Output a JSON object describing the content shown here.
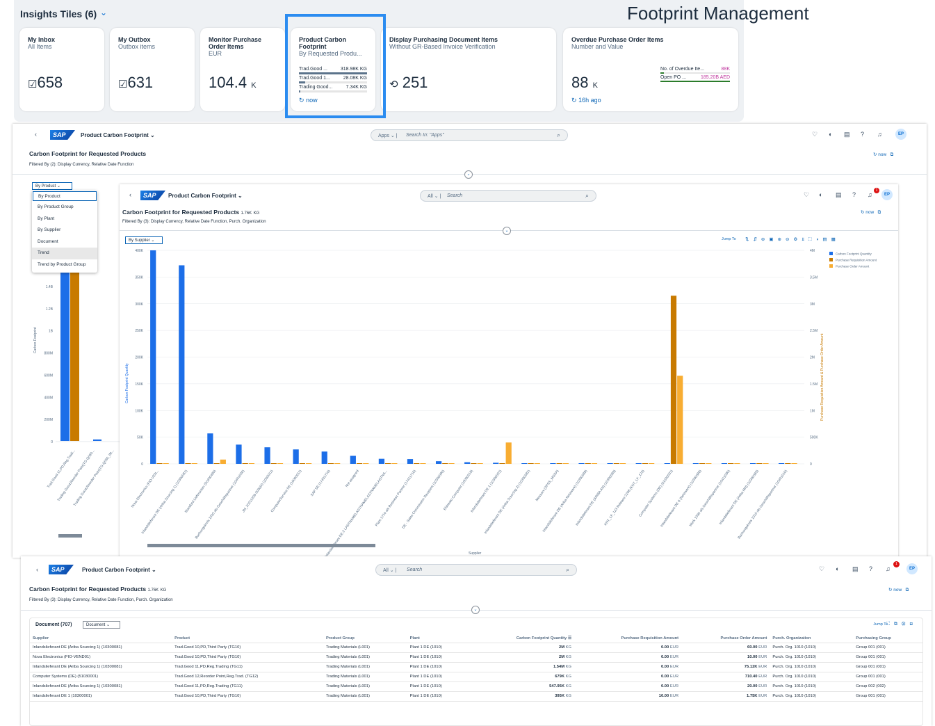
{
  "overlay": {
    "title": "Footprint Management"
  },
  "insights": {
    "title": "Insights Tiles (6)",
    "tiles": [
      {
        "title": "My Inbox",
        "subtitle": "All Items",
        "value": "658",
        "icon": "inbox-check-icon"
      },
      {
        "title": "My Outbox",
        "subtitle": "Outbox items",
        "value": "631",
        "icon": "outbox-check-icon"
      },
      {
        "title": "Monitor Purchase Order Items",
        "subtitle": "EUR",
        "value": "104.4",
        "unit": "K"
      },
      {
        "title": "Product Carbon Footprint",
        "subtitle": "By Requested Produ...",
        "rows": [
          {
            "label": "Trad.Good ...",
            "value": "318.98K KG",
            "fill": 1.0
          },
          {
            "label": "Trad.Good 1...",
            "value": "28.08K KG",
            "fill": 0.09
          },
          {
            "label": "Trading Good...",
            "value": "7.34K KG",
            "fill": 0.02
          }
        ],
        "refresh": "now"
      },
      {
        "title": "Display Purchasing Document Items",
        "subtitle": "Without GR-Based Invoice Verification",
        "value": "251",
        "icon": "document-sync-icon"
      },
      {
        "title": "Overdue Purchase Order Items",
        "subtitle": "Number and Value",
        "value": "88",
        "unit": "K",
        "rows": [
          {
            "label": "No. of Overdue Ite...",
            "value": "88K",
            "fill": 0.05
          },
          {
            "label": "Open PO ...",
            "value": "185.20B AED",
            "fill": 1.0
          }
        ],
        "refresh": "16h ago"
      }
    ]
  },
  "shell": {
    "app": "Product Carbon Footprint",
    "search_cat_apps": "Apps",
    "search_ph_apps": "Search In: \"Apps\"",
    "search_cat_all": "All",
    "search_ph_all": "Search",
    "avatar": "EP",
    "badge": "1"
  },
  "page": {
    "title": "Carbon Footprint for Requested Products",
    "total": "1.76K",
    "total_unit": "KG",
    "filter2": "Filtered By (2): Display Currency, Relative Date Function",
    "filter3": "Filtered By (3): Display Currency, Relative Date Function, Purch. Organization",
    "refresh": "now",
    "jump_to": "Jump To"
  },
  "back_chart": {
    "view": "By Product",
    "ylabel": "Carbon Footprint",
    "menu": [
      "By Product",
      "By Product Group",
      "By Plant",
      "By Supplier",
      "Document",
      "Trend",
      "Trend by Product Group"
    ],
    "ticks": [
      "1.4B",
      "1.2B",
      "1B",
      "800M",
      "600M",
      "400M",
      "200M",
      "0"
    ],
    "categories": [
      "Trad.Good 11,PD,Reg.Tradi...",
      "Trading Good,Reorder Point(TG-Q060...",
      "Trading Good,Reorder Point(TG-Q060_IM..."
    ]
  },
  "chart_data": {
    "type": "bar",
    "view": "By Supplier",
    "xlabel": "Supplier",
    "ylabel": "Carbon Footprint Quantity",
    "y2label": "Purchase Requisition Amount & Purchase Order Amount",
    "ylim": [
      0,
      400000
    ],
    "y2lim": [
      0,
      4000000
    ],
    "yticks": [
      "400K",
      "350K",
      "300K",
      "250K",
      "200K",
      "150K",
      "100K",
      "50K",
      "0"
    ],
    "y2ticks": [
      "4M",
      "3.5M",
      "3M",
      "2.5M",
      "2M",
      "1.5M",
      "1M",
      "500K",
      "0"
    ],
    "legend": [
      "Carbon Footprint Quantity",
      "Purchase Requisition Amount",
      "Purchase Order Amount"
    ],
    "colors": [
      "#1c6ee8",
      "#c87a00",
      "#f8ad32"
    ],
    "categories": [
      "Nova Electronics (FIO-VEN...",
      "Inlandslieferant DE (Ariba Sourcing 1) (10300081)",
      "Standard Lieferanten (S0400480)",
      "Buchungskreis 1030 als Geschäftspartner (10401030)",
      "JM_20211208-000000 (1000011)",
      "ComputerService SE (10000011)",
      "SAP SE (17401710)",
      "Not assigned",
      "Inlandslieferant DE 2 LASTNAMELASTNAMELASTNAMELASTNA...",
      "Plant 1710 als Business Partner (17411710)",
      "DE - Sales Commission Recipient (10300090)",
      "Elsbeato Computer (10000019)",
      "Inlandslieferant DE 1 (10300001)",
      "Inlandslieferant DE (Ariba Sourcing 2) (10300082)",
      "Messorx (ZPSS_MSSA)",
      "Inlandslieferant DE (Ariba Netzwerk) (10300088)",
      "Inlandslieferant DE (ARIBA AN) (10300089)",
      "KNT_LF_123 Release 2208 (KNT_LF_123)",
      "Computer Systems (DE) (51030001)",
      "Inlandslieferant DE 6 (Netzwerk) (10300086)",
      "Werk 1090 als Geschäftspartner (10411090)",
      "Inlandslieferant DE (Ariba MN) (10300085)",
      "Buchungskreis 1010 als Geschäftspartner (10401010)"
    ],
    "series": [
      {
        "name": "Carbon Footprint Quantity",
        "values": [
          400000,
          372000,
          57000,
          36000,
          31000,
          27000,
          23000,
          15000,
          9500,
          9000,
          5000,
          3000,
          2000,
          1000,
          800,
          700,
          600,
          500,
          400,
          300,
          300,
          200,
          200
        ]
      },
      {
        "name": "Purchase Requisition Amount",
        "values": [
          0,
          0,
          0,
          0,
          0,
          0,
          0,
          0,
          0,
          0,
          0,
          0,
          0,
          0,
          0,
          0,
          0,
          0,
          3150000,
          0,
          0,
          0,
          0
        ]
      },
      {
        "name": "Purchase Order Amount",
        "values": [
          0,
          0,
          80000,
          0,
          0,
          0,
          0,
          0,
          0,
          0,
          0,
          0,
          400000,
          0,
          0,
          0,
          0,
          0,
          1650000,
          0,
          0,
          0,
          0
        ]
      }
    ]
  },
  "table": {
    "title": "Document (707)",
    "view": "Document",
    "columns": [
      "Supplier",
      "Product",
      "Product Group",
      "Plant",
      "Carbon Footprint Quantity",
      "Purchase Requisition Amount",
      "Purchase Order Amount",
      "Purch. Organization",
      "Purchasing Group"
    ],
    "rows": [
      [
        "Inlandslieferant DE (Ariba Sourcing 1) (10300081)",
        "Trad.Good 10,PD,Third Party (TG10)",
        "Trading Materials (L001)",
        "Plant 1 DE (1010)",
        "2M",
        "0.00",
        "60.00",
        "Purch. Org. 1010 (1010)",
        "Group 001 (001)"
      ],
      [
        "Nova Electronics (FIO-VEND01)",
        "Trad.Good 10,PD,Third Party (TG10)",
        "Trading Materials (L001)",
        "Plant 1 DE (1010)",
        "2M",
        "0.00",
        "10.00",
        "Purch. Org. 1010 (1010)",
        "Group 001 (001)"
      ],
      [
        "Inlandslieferant DE (Ariba Sourcing 1) (10300081)",
        "Trad.Good 11,PD,Reg.Trading (TG11)",
        "Trading Materials (L001)",
        "Plant 1 DE (1010)",
        "1.54M",
        "0.00",
        "75.12K",
        "Purch. Org. 1010 (1010)",
        "Group 001 (001)"
      ],
      [
        "Computer Systems (DE) (51030001)",
        "Trad.Good 12,Reorder Point,Reg.Trad. (TG12)",
        "Trading Materials (L001)",
        "Plant 1 DE (1010)",
        "679K",
        "0.00",
        "710.40",
        "Purch. Org. 1010 (1010)",
        "Group 001 (001)"
      ],
      [
        "Inlandslieferant DE (Ariba Sourcing 1) (10300081)",
        "Trad.Good 11,PD,Reg.Trading (TG11)",
        "Trading Materials (L001)",
        "Plant 1 DE (1010)",
        "547.95K",
        "0.00",
        "20.00",
        "Purch. Org. 1010 (1010)",
        "Group 002 (002)"
      ],
      [
        "Inlandslieferant DE 1 (10300001)",
        "Trad.Good 10,PD,Third Party (TG10)",
        "Trading Materials (L001)",
        "Plant 1 DE (1010)",
        "395K",
        "10.00",
        "1.75K",
        "Purch. Org. 1010 (1010)",
        "Group 001 (001)"
      ]
    ],
    "units": {
      "qty": "KG",
      "cur": "EUR"
    }
  }
}
